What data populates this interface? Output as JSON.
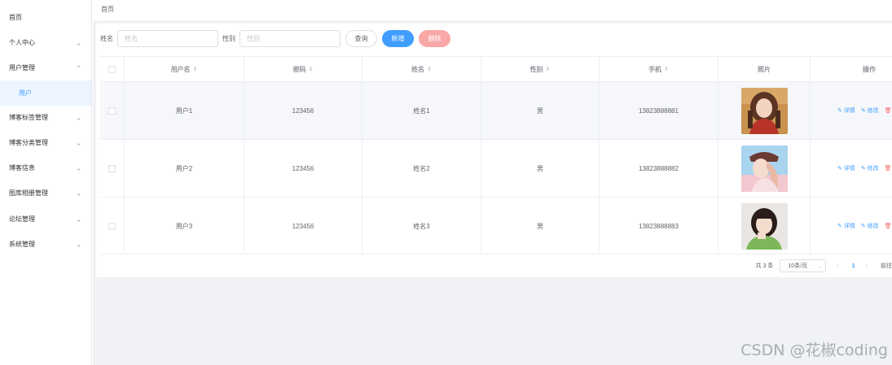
{
  "sidebar": {
    "items": [
      {
        "label": "首页",
        "chevron": ""
      },
      {
        "label": "个人中心",
        "chevron": "⌄"
      },
      {
        "label": "用户管理",
        "chevron": "⌃"
      },
      {
        "label": "用户",
        "chevron": ""
      },
      {
        "label": "博客标签管理",
        "chevron": "⌄"
      },
      {
        "label": "博客分类管理",
        "chevron": "⌄"
      },
      {
        "label": "博客信息",
        "chevron": "⌄"
      },
      {
        "label": "图库相册管理",
        "chevron": "⌄"
      },
      {
        "label": "论坛管理",
        "chevron": "⌄"
      },
      {
        "label": "系统管理",
        "chevron": "⌄"
      }
    ]
  },
  "breadcrumb": {
    "label": "首页"
  },
  "search": {
    "name_label": "姓名",
    "name_placeholder": "姓名",
    "gender_label": "性别",
    "gender_placeholder": "性别",
    "query_button": "查询",
    "add_button": "新增",
    "delete_button": "删除"
  },
  "table": {
    "headers": [
      "用户名",
      "密码",
      "姓名",
      "性别",
      "手机",
      "照片",
      "操作"
    ],
    "sort_icon": "⇕",
    "rows": [
      {
        "username": "用户1",
        "password": "123456",
        "name": "姓名1",
        "gender": "男",
        "phone": "13823888881",
        "photo": "photo-1"
      },
      {
        "username": "用户2",
        "password": "123456",
        "name": "姓名2",
        "gender": "男",
        "phone": "13823888882",
        "photo": "photo-2"
      },
      {
        "username": "用户3",
        "password": "123456",
        "name": "姓名3",
        "gender": "男",
        "phone": "13823888883",
        "photo": "photo-3"
      }
    ],
    "actions": {
      "detail": "详情",
      "edit": "修改",
      "delete": "删"
    }
  },
  "pagination": {
    "total": "共 3 条",
    "page_size": "10条/页",
    "prev": "‹",
    "current": "1",
    "next": "›",
    "goto": "前往"
  },
  "watermark": "CSDN @花椒coding",
  "colors": {
    "primary": "#409eff",
    "danger": "#f56c6c",
    "danger_plain": "#f9a7a7",
    "bg": "#f0f2f5"
  }
}
